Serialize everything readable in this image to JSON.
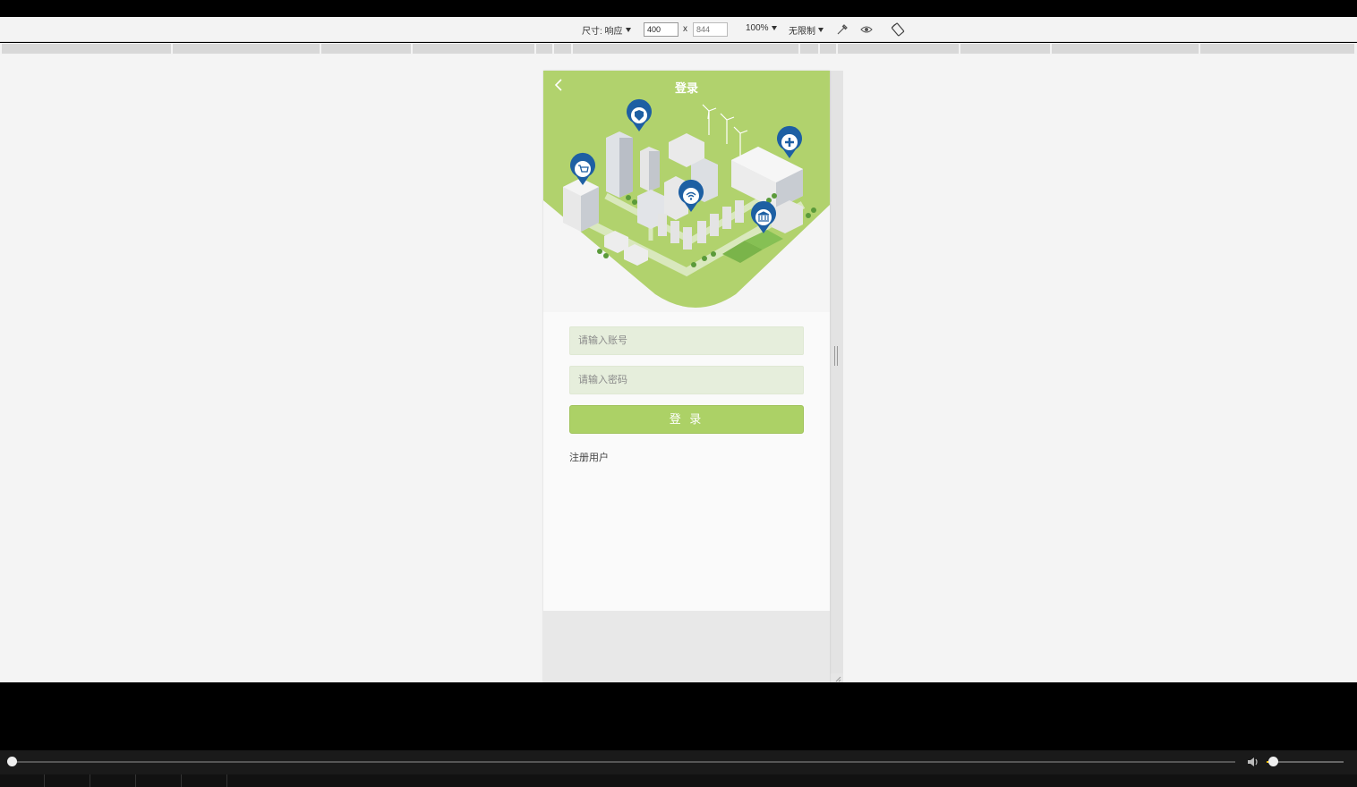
{
  "devtools": {
    "size_label": "尺寸: 响应",
    "width_value": "400",
    "height_placeholder": "844",
    "times": "x",
    "zoom": "100%",
    "throttle": "无限制"
  },
  "app": {
    "title": "登录",
    "account_placeholder": "请输入账号",
    "password_placeholder": "请输入密码",
    "login_button": "登 录",
    "register_link": "注册用户"
  },
  "colors": {
    "brand_green": "#acd166",
    "hero_green": "#b1d26d",
    "pin_blue": "#1d5fa3"
  },
  "player": {
    "seek_progress": 0.0,
    "volume": 0.1
  }
}
